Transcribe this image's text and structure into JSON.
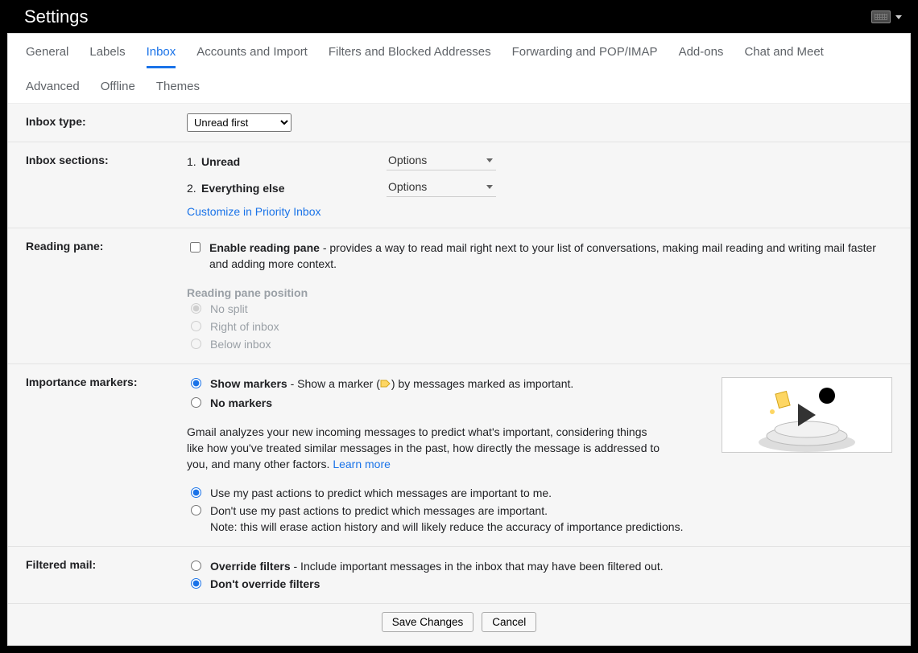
{
  "page_title": "Settings",
  "tabs": [
    "General",
    "Labels",
    "Inbox",
    "Accounts and Import",
    "Filters and Blocked Addresses",
    "Forwarding and POP/IMAP",
    "Add-ons",
    "Chat and Meet",
    "Advanced",
    "Offline",
    "Themes"
  ],
  "active_tab": "Inbox",
  "inbox_type": {
    "label": "Inbox type:",
    "selected": "Unread first"
  },
  "inbox_sections": {
    "label": "Inbox sections:",
    "items": [
      {
        "index": "1.",
        "name": "Unread",
        "options_label": "Options"
      },
      {
        "index": "2.",
        "name": "Everything else",
        "options_label": "Options"
      }
    ],
    "customize_link": "Customize in Priority Inbox"
  },
  "reading_pane": {
    "label": "Reading pane:",
    "enable_label": "Enable reading pane",
    "enable_desc": " - provides a way to read mail right next to your list of conversations, making mail reading and writing mail faster and adding more context.",
    "enable_checked": false,
    "position_heading": "Reading pane position",
    "options": [
      {
        "label": "No split",
        "checked": true
      },
      {
        "label": "Right of inbox",
        "checked": false
      },
      {
        "label": "Below inbox",
        "checked": false
      }
    ]
  },
  "importance": {
    "label": "Importance markers:",
    "show": {
      "label": "Show markers",
      "desc_before": " - Show a marker (",
      "desc_after": ") by messages marked as important.",
      "checked": true
    },
    "no_markers": {
      "label": "No markers",
      "checked": false
    },
    "explain": "Gmail analyzes your new incoming messages to predict what's important, considering things like how you've treated similar messages in the past, how directly the message is addressed to you, and many other factors. ",
    "learn_more": "Learn more",
    "predict_yes": {
      "label": "Use my past actions to predict which messages are important to me.",
      "checked": true
    },
    "predict_no": {
      "label": "Don't use my past actions to predict which messages are important.",
      "note": "Note: this will erase action history and will likely reduce the accuracy of importance predictions.",
      "checked": false
    }
  },
  "filtered": {
    "label": "Filtered mail:",
    "override": {
      "label": "Override filters",
      "desc": " - Include important messages in the inbox that may have been filtered out.",
      "checked": false
    },
    "no_override": {
      "label": "Don't override filters",
      "checked": true
    }
  },
  "buttons": {
    "save": "Save Changes",
    "cancel": "Cancel"
  }
}
